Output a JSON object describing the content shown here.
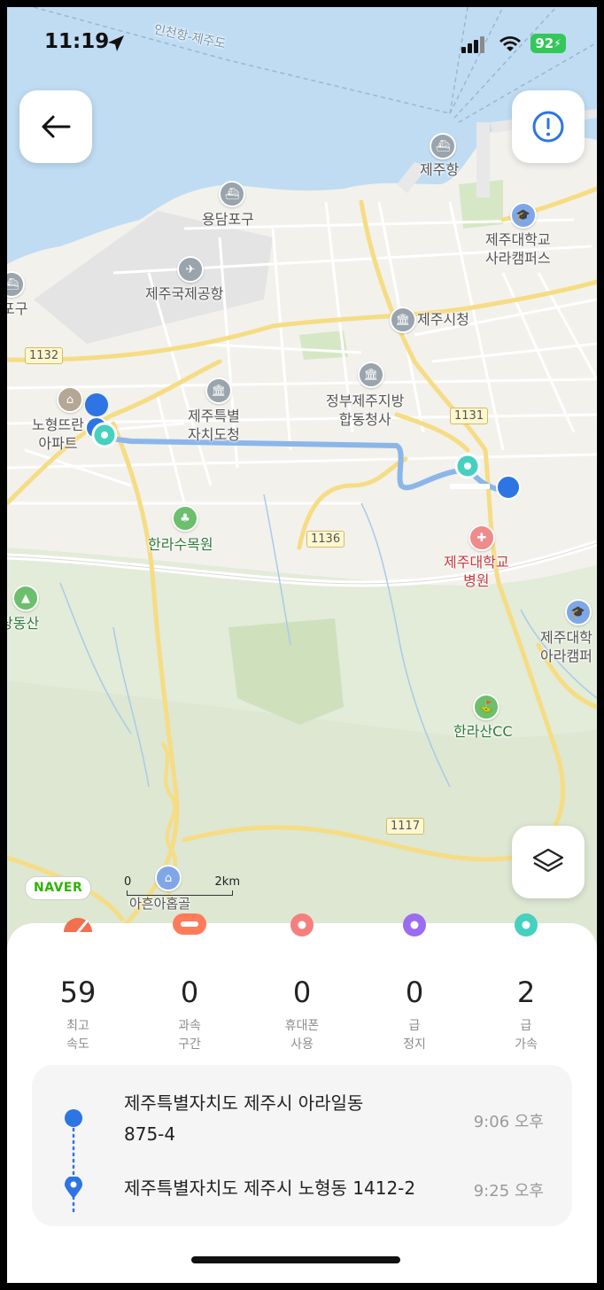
{
  "status_bar": {
    "time": "11:19",
    "battery": "92"
  },
  "map": {
    "labels": {
      "sea_route": "인천항-제주도",
      "jeju_port": "제주항",
      "yongdampogu": "용담포구",
      "airport": "제주국제공항",
      "univ_sara": "제주대학교\n사라캠퍼스",
      "city_hall": "제주시청",
      "gov_complex": "정부제주지방\n합동청사",
      "province_office": "제주특별\n자치도청",
      "nohyeong_apt": "노형뜨란\n아파트",
      "arboretum": "한라수목원",
      "univ_hospital": "제주대학교\n병원",
      "univ_ara": "제주대학\n아라캠퍼",
      "halla_cc": "한라산CC",
      "dangdongsan": "당동산",
      "left_cut": "포구",
      "bottom_poi": "아흔아홉골"
    },
    "roads": {
      "r1132": "1132",
      "r1131": "1131",
      "r1136": "1136",
      "r1117": "1117"
    },
    "naver_logo": "NAVER",
    "scale": {
      "start": "0",
      "end": "2km"
    }
  },
  "stats": [
    {
      "value": "59",
      "label": "최고\n속도",
      "color": "#f0704f"
    },
    {
      "value": "0",
      "label": "과속\n구간",
      "color": "#ff7b5a"
    },
    {
      "value": "0",
      "label": "휴대폰\n사용",
      "color": "#f57f7f"
    },
    {
      "value": "0",
      "label": "급\n정지",
      "color": "#9b6cf0"
    },
    {
      "value": "2",
      "label": "급\n가속",
      "color": "#45d0c0"
    }
  ],
  "trip": {
    "start_address": "제주특별자치도 제주시 아라일동\n875-4",
    "start_time": "9:06 오후",
    "end_address": "제주특별자치도 제주시 노형동 1412-2",
    "end_time": "9:25 오후"
  },
  "colors": {
    "accent": "#2d75e3",
    "teal": "#45d0c0",
    "route": "#8bb6ea"
  }
}
